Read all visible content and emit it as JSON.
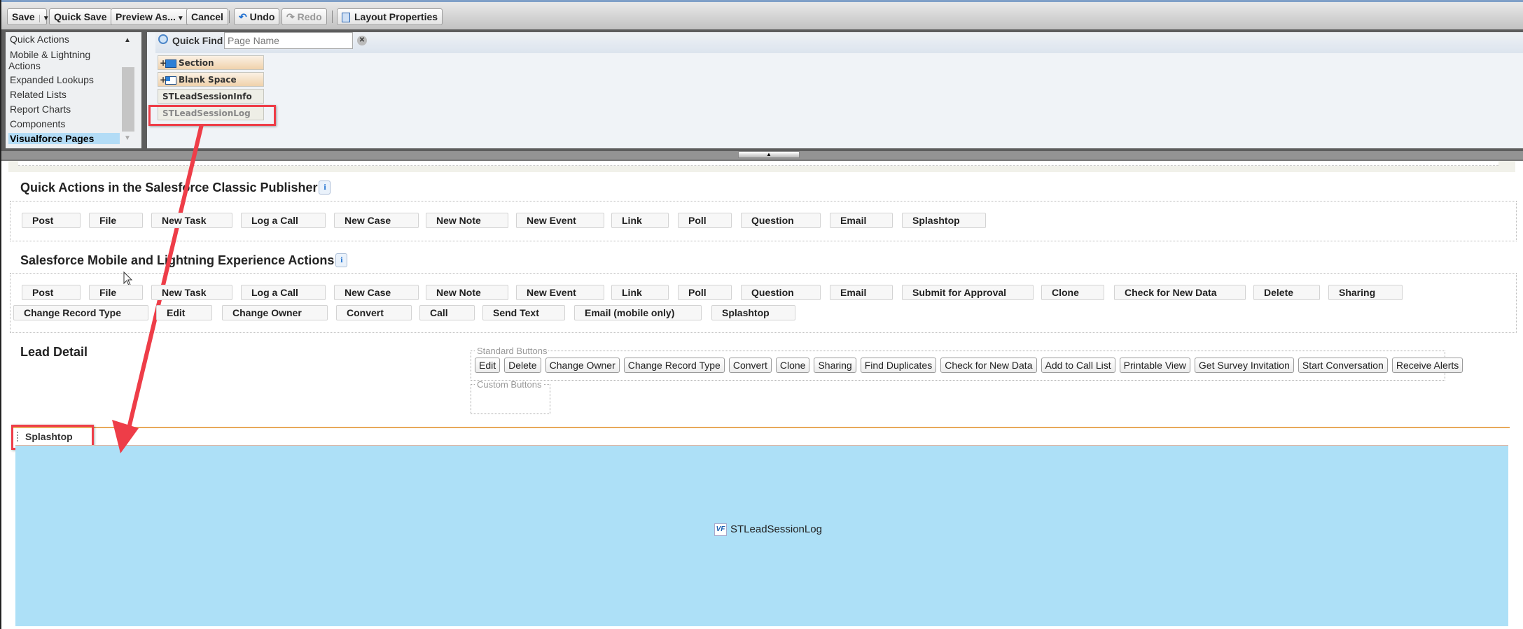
{
  "toolbar": {
    "save": "Save",
    "quick_save": "Quick Save",
    "preview_as": "Preview As...",
    "cancel": "Cancel",
    "undo": "Undo",
    "redo": "Redo",
    "layout_properties": "Layout Properties"
  },
  "palette": {
    "categories": [
      {
        "label": "Quick Actions"
      },
      {
        "label": "Mobile & Lightning"
      },
      {
        "label": "Actions"
      },
      {
        "label": "Expanded Lookups"
      },
      {
        "label": "Related Lists"
      },
      {
        "label": "Report Charts"
      },
      {
        "label": "Components"
      },
      {
        "label": "Visualforce Pages"
      }
    ],
    "selected_category": "Visualforce Pages",
    "quick_find_label": "Quick Find",
    "quick_find_placeholder": "Page Name",
    "quick_find_value": "",
    "items": [
      {
        "label": "Section",
        "type": "section"
      },
      {
        "label": "Blank Space",
        "type": "blank"
      },
      {
        "label": "STLeadSessionInfo",
        "used": false
      },
      {
        "label": "STLeadSessionLog",
        "used": true
      }
    ]
  },
  "quick_actions": {
    "title": "Quick Actions in the Salesforce Classic Publisher",
    "info": "i",
    "buttons": [
      "Post",
      "File",
      "New Task",
      "Log a Call",
      "New Case",
      "New Note",
      "New Event",
      "Link",
      "Poll",
      "Question",
      "Email",
      "Splashtop"
    ]
  },
  "mobile_actions": {
    "title": "Salesforce Mobile and Lightning Experience Actions",
    "info": "i",
    "row1": [
      "Post",
      "File",
      "New Task",
      "Log a Call",
      "New Case",
      "New Note",
      "New Event",
      "Link",
      "Poll",
      "Question",
      "Email",
      "Submit for Approval",
      "Clone",
      "Check for New Data",
      "Delete",
      "Sharing"
    ],
    "row2": [
      "Change Record Type",
      "Edit",
      "Change Owner",
      "Convert",
      "Call",
      "Send Text",
      "Email (mobile only)",
      "Splashtop"
    ]
  },
  "lead_detail": {
    "title": "Lead Detail",
    "standard_buttons_legend": "Standard Buttons",
    "standard_buttons": [
      "Edit",
      "Delete",
      "Change Owner",
      "Change Record Type",
      "Convert",
      "Clone",
      "Sharing",
      "Find Duplicates",
      "Check for New Data",
      "Add to Call List",
      "Printable View",
      "Get Survey Invitation",
      "Start Conversation",
      "Receive Alerts"
    ],
    "custom_buttons_legend": "Custom Buttons"
  },
  "vf_section": {
    "title": "Splashtop",
    "page_icon": "VF",
    "page_name": "STLeadSessionLog"
  },
  "colors": {
    "highlight": "#ee3d48",
    "vf_area": "#ade0f7",
    "selected_category": "#b3dcf6",
    "section_divider": "#e8a95a"
  }
}
